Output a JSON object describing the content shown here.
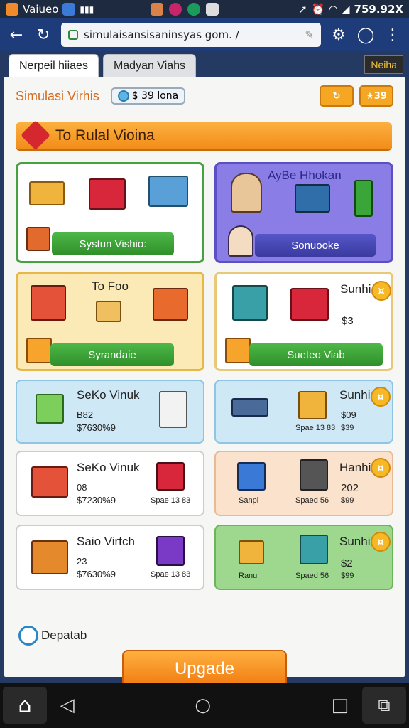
{
  "status_bar": {
    "left_text": "Vaiueo",
    "right_text": "759.92X"
  },
  "browser": {
    "url": "simulaisansisaninsyas gom. /"
  },
  "tabs": [
    {
      "label": "Nerpeil hiiaes"
    },
    {
      "label": "Madyan Viahs"
    }
  ],
  "corner_badge": "Neiha",
  "header": {
    "app_title": "Simulasi Virhis",
    "coin_value": "$ 39 lona",
    "right_btn_label": "39"
  },
  "banner": {
    "title": "To Rulal Vioina"
  },
  "cards": {
    "c1": {
      "button": "Systun Vishio:"
    },
    "c2": {
      "title": "AyBe Hhokan",
      "button": "Sonuooke"
    },
    "c3": {
      "title": "To Foo",
      "button": "Syrandaie"
    },
    "c4": {
      "title": "Sunhi",
      "price": "$3",
      "button": "Sueteo Viab"
    },
    "c5": {
      "title": "SeKo Vinuk",
      "line1": "B82",
      "line2": "$7630%9"
    },
    "c6": {
      "title": "Sunhi",
      "line1": "$09",
      "label_a": "Spae 13 83",
      "label_b": "$39"
    },
    "c7": {
      "title": "SeKo Vinuk",
      "line1": "08",
      "line2": "$7230%9",
      "label": "Spae 13 83"
    },
    "c8": {
      "title": "Hanhi",
      "line1": "202",
      "label_a": "Sanpi",
      "label_b": "Spaed 56",
      "label_c": "$99"
    },
    "c9": {
      "title": "Saio Virtch",
      "line1": "23",
      "line2": "$7630%9",
      "label": "Spae 13 83"
    },
    "c10": {
      "title": "Sunhi",
      "line1": "$2",
      "label_a": "Ranu",
      "label_b": "Spaed 56",
      "label_c": "$99"
    }
  },
  "footer": {
    "label": "Depatab",
    "upgrade": "Upgade"
  },
  "colors": {
    "accent_orange": "#f5a623",
    "green": "#3aa63a",
    "purple": "#7a6ad8"
  }
}
